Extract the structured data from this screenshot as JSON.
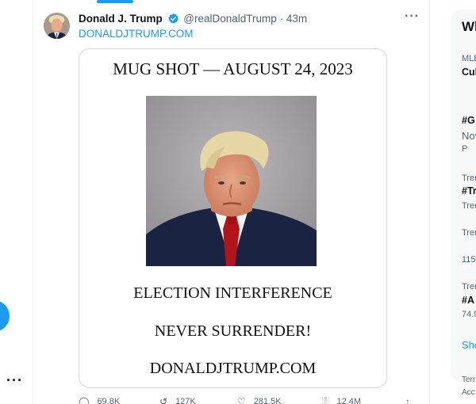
{
  "tweet": {
    "display_name": "Donald J. Trump",
    "handle": "@realDonaldTrump",
    "separator": "·",
    "time": "43m",
    "link_text": "DONALDJTRUMP.COM",
    "more_label": "···"
  },
  "media": {
    "title": "MUG SHOT — AUGUST 24, 2023",
    "line1": "ELECTION INTERFERENCE",
    "line2": "NEVER SURRENDER!",
    "line3": "DONALDJTRUMP.COM"
  },
  "actions": {
    "replies": "69.8K",
    "reposts": "127K",
    "likes": "281.5K",
    "views": "12.4M"
  },
  "sidebar": {
    "title": "Wh",
    "t1": "MLB",
    "t2": "Cul",
    "t3": "#G",
    "t4": "Nov",
    "t5": "P",
    "t6": "Trer",
    "t7": "#Tr",
    "t8": "Trer",
    "t9": "Trer",
    "t10": "115k",
    "t11": "Trer",
    "t12": "#A",
    "t13": "74.9",
    "show": "Sho",
    "footer1": "Terr",
    "footer2": "Acc"
  },
  "nav": {
    "more_label": "···"
  },
  "colors": {
    "accent": "#1d9bf0",
    "text": "#0f1419",
    "muted": "#536471"
  }
}
